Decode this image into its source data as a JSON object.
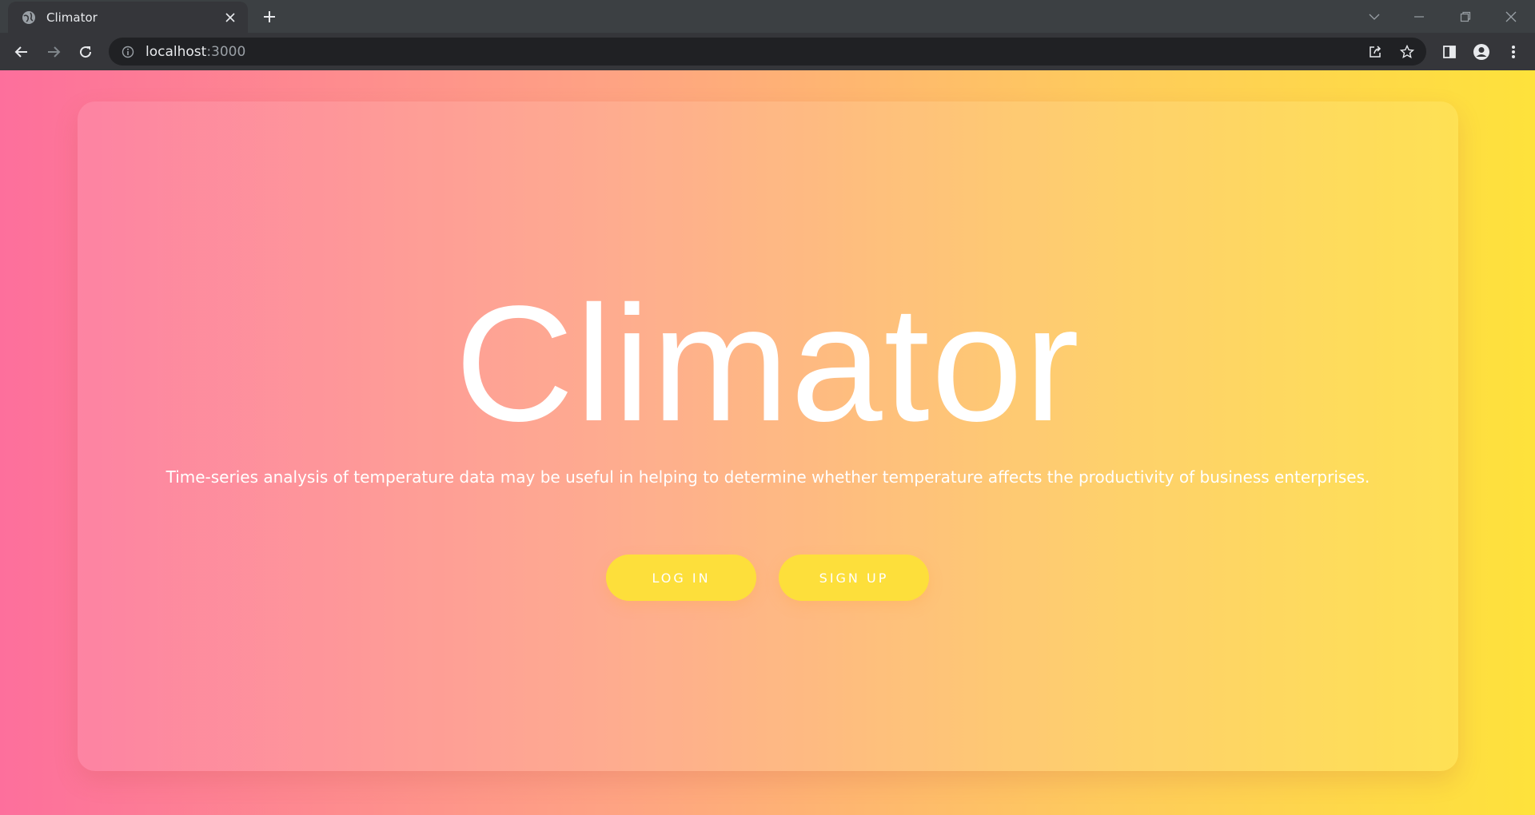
{
  "browser": {
    "tab_title": "Climator",
    "url_host": "localhost",
    "url_port": ":3000"
  },
  "page": {
    "title": "Climator",
    "subtitle": "Time-series analysis of temperature data may be useful in helping to determine whether temperature affects the productivity of business enterprises.",
    "login_label": "LOG IN",
    "signup_label": "SIGN UP"
  },
  "colors": {
    "gradient_start": "#fd6f9c",
    "gradient_end": "#fee23b",
    "button": "#fddf3b"
  },
  "icons": [
    "globe-icon",
    "close-icon",
    "plus-icon",
    "back-icon",
    "forward-icon",
    "reload-icon",
    "info-icon",
    "share-icon",
    "star-icon",
    "sidepanel-icon",
    "profile-icon",
    "menu-icon",
    "minimize-icon",
    "restore-icon",
    "window-close-icon",
    "tab-search-icon"
  ]
}
